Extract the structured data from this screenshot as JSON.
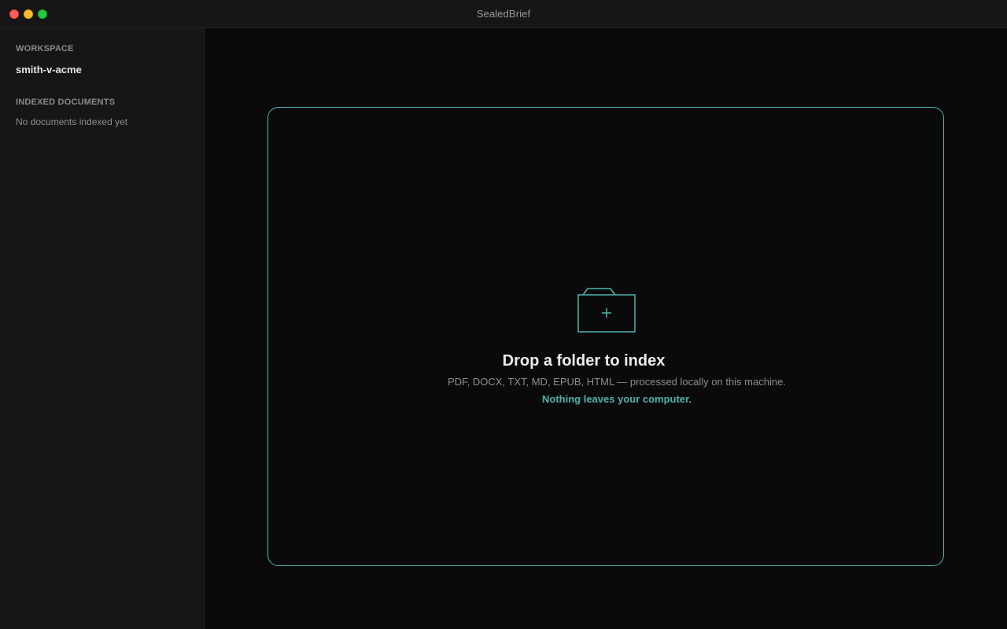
{
  "window": {
    "title": "SealedBrief"
  },
  "sidebar": {
    "workspace_label": "WORKSPACE",
    "workspace_name": "smith-v-acme",
    "indexed_label": "INDEXED DOCUMENTS",
    "empty_text": "No documents indexed yet"
  },
  "dropzone": {
    "icon": "folder-plus-icon",
    "title": "Drop a folder to index",
    "subtitle": "PDF, DOCX, TXT, MD, EPUB, HTML — processed locally on this machine.",
    "note": "Nothing leaves your computer."
  },
  "colors": {
    "accent": "#4fb3ac",
    "background": "#0a0a0b",
    "sidebar": "#161617",
    "close": "#fe5f57",
    "minimize": "#febc2e",
    "maximize": "#28c840"
  }
}
